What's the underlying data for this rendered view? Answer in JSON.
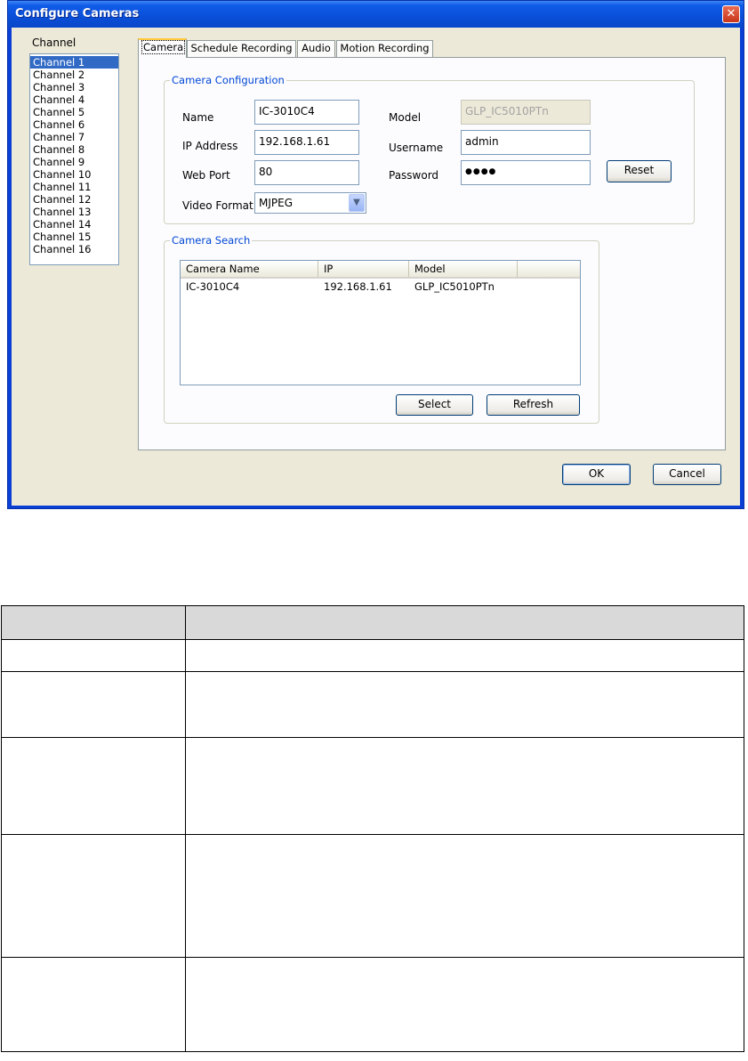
{
  "window": {
    "title": "Configure Cameras",
    "close_glyph": "✕"
  },
  "channels": {
    "label": "Channel",
    "items": [
      "Channel 1",
      "Channel 2",
      "Channel 3",
      "Channel 4",
      "Channel 5",
      "Channel 6",
      "Channel 7",
      "Channel 8",
      "Channel 9",
      "Channel 10",
      "Channel 11",
      "Channel 12",
      "Channel 13",
      "Channel 14",
      "Channel 15",
      "Channel 16"
    ],
    "selected": "Channel 1"
  },
  "tabs": [
    {
      "label": "Camera",
      "active": true
    },
    {
      "label": "Schedule Recording",
      "active": false
    },
    {
      "label": "Audio",
      "active": false
    },
    {
      "label": "Motion Recording",
      "active": false
    }
  ],
  "camera_config": {
    "title": "Camera Configuration",
    "name_label": "Name",
    "name_value": "IC-3010C4",
    "ip_label": "IP Address",
    "ip_value": "192.168.1.61",
    "port_label": "Web Port",
    "port_value": "80",
    "format_label": "Video Format",
    "format_value": "MJPEG",
    "model_label": "Model",
    "model_value": "GLP_IC5010PTn",
    "username_label": "Username",
    "username_value": "admin",
    "password_label": "Password",
    "password_value": "●●●●",
    "reset_label": "Reset",
    "combo_arrow_icon": "chevron-down-icon"
  },
  "camera_search": {
    "title": "Camera Search",
    "columns": [
      "Camera Name",
      "IP",
      "Model"
    ],
    "rows": [
      [
        "IC-3010C4",
        "192.168.1.61",
        "GLP_IC5010PTn"
      ]
    ],
    "select_label": "Select",
    "refresh_label": "Refresh"
  },
  "footer": {
    "ok_label": "OK",
    "cancel_label": "Cancel"
  },
  "colors": {
    "title_bar": "#0a4fd8",
    "dialog_bg": "#ece9d8",
    "selection": "#316ac5",
    "group_title": "#0046d5"
  }
}
